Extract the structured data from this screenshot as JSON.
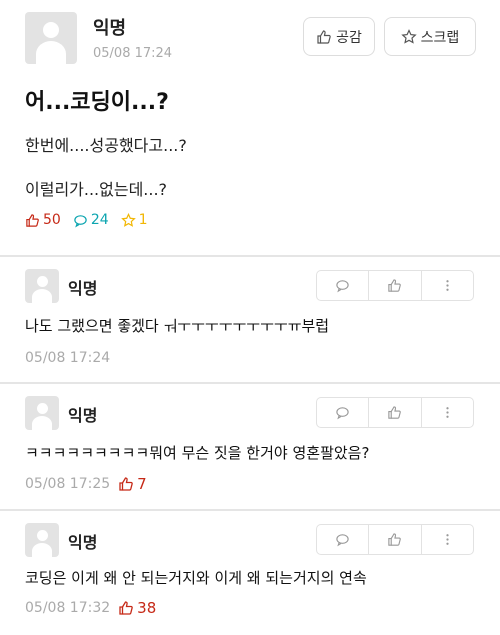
{
  "post": {
    "author": "익명",
    "timestamp": "05/08 17:24",
    "like_button_label": "공감",
    "scrap_button_label": "스크랩",
    "title": "어...코딩이...?",
    "body_lines": [
      "한번에....성공했다고...?",
      "이럴리가...없는데...?"
    ],
    "stats": {
      "likes": "50",
      "comments": "24",
      "scraps": "1"
    }
  },
  "comments": [
    {
      "author": "익명",
      "text": "나도 그랬으면 좋겠다 ㅝㅜㅜㅜㅜㅜㅜㅜㅜㅠ부럽",
      "timestamp": "05/08 17:24",
      "likes": ""
    },
    {
      "author": "익명",
      "text": "ㅋㅋㅋㅋㅋㅋㅋㅋㅋ뭐여 무슨 짓을 한거야 영혼팔았음?",
      "timestamp": "05/08 17:25",
      "likes": "7"
    },
    {
      "author": "익명",
      "text": "코딩은 이게 왜 안 되는거지와 이게 왜 되는거지의 연속",
      "timestamp": "05/08 17:32",
      "likes": "38"
    }
  ],
  "colors": {
    "like": "#c62917",
    "comment": "#0ca5b0",
    "scrap": "#f2b705",
    "meta": "#aaaaaa"
  }
}
